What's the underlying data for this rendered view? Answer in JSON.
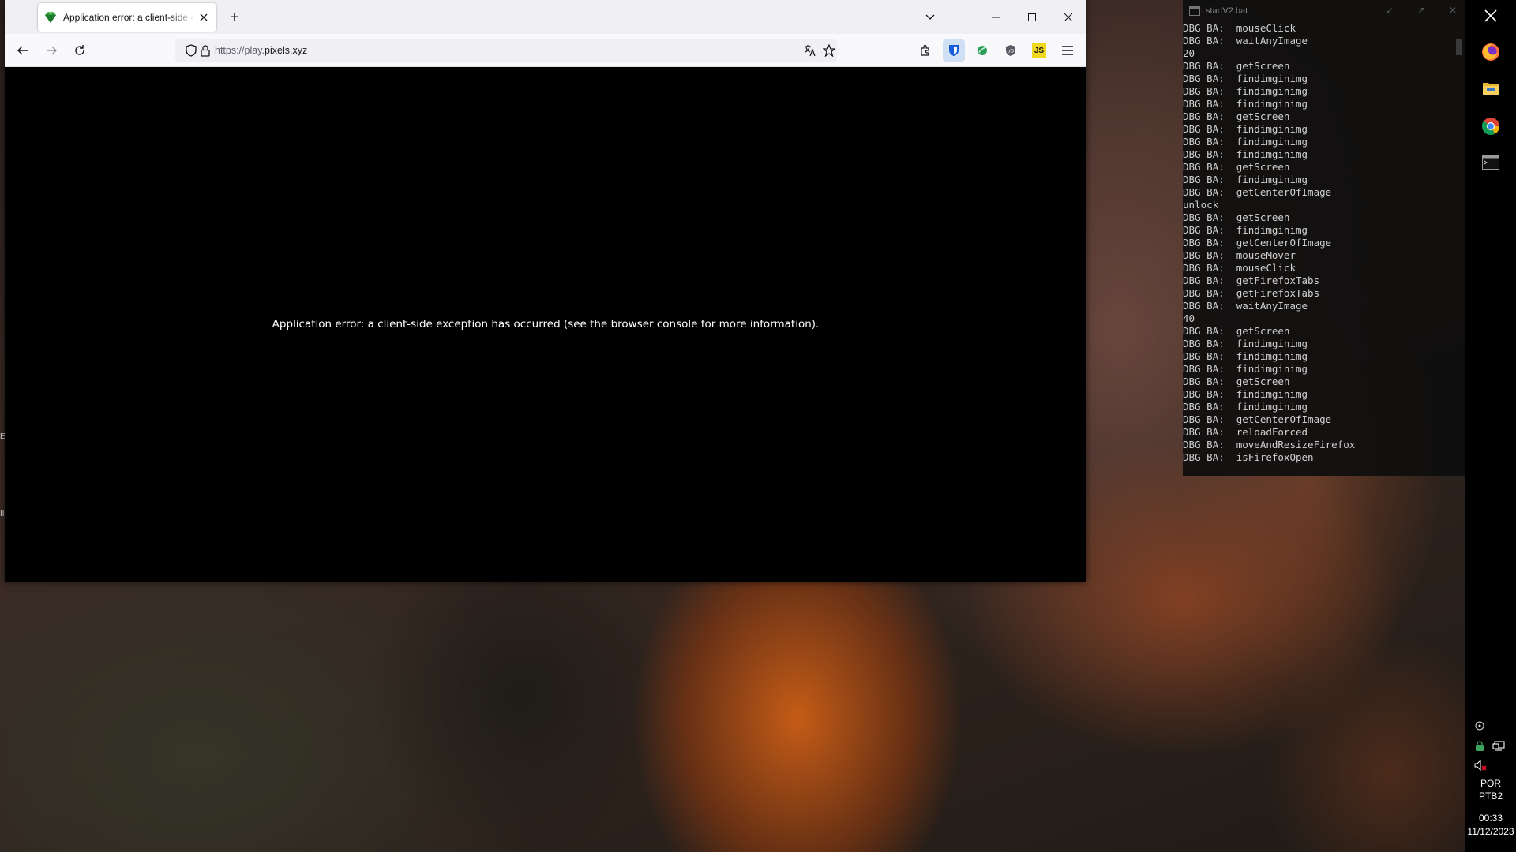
{
  "browser": {
    "tab": {
      "title": "Application error: a client-side exception has occurred"
    },
    "new_tab_symbol": "+",
    "url": {
      "protocol": "https://",
      "prefix": "play.",
      "host": "pixels.xyz"
    },
    "icons": {
      "back": "back-arrow-icon",
      "forward": "forward-arrow-icon",
      "reload": "reload-icon",
      "tracking": "shield-icon",
      "lock": "lock-icon",
      "translate": "translate-icon",
      "bookmark": "star-icon",
      "extensions": "puzzle-icon",
      "menu": "hamburger-menu-icon"
    },
    "extension_badge_js": "JS",
    "error_message": "Application error: a client-side exception has occurred (see the browser console for more information)."
  },
  "console": {
    "title": "startV2.bat",
    "lines": [
      "DBG BA:  mouseClick",
      "DBG BA:  waitAnyImage",
      "20",
      "DBG BA:  getScreen",
      "DBG BA:  findimginimg",
      "DBG BA:  findimginimg",
      "DBG BA:  findimginimg",
      "DBG BA:  getScreen",
      "DBG BA:  findimginimg",
      "DBG BA:  findimginimg",
      "DBG BA:  findimginimg",
      "DBG BA:  getScreen",
      "DBG BA:  findimginimg",
      "DBG BA:  getCenterOfImage",
      "unlock",
      "DBG BA:  getScreen",
      "DBG BA:  findimginimg",
      "DBG BA:  getCenterOfImage",
      "DBG BA:  mouseMover",
      "DBG BA:  mouseClick",
      "DBG BA:  getFirefoxTabs",
      "DBG BA:  getFirefoxTabs",
      "DBG BA:  waitAnyImage",
      "40",
      "DBG BA:  getScreen",
      "DBG BA:  findimginimg",
      "DBG BA:  findimginimg",
      "DBG BA:  findimginimg",
      "DBG BA:  getScreen",
      "DBG BA:  findimginimg",
      "DBG BA:  findimginimg",
      "DBG BA:  getCenterOfImage",
      "DBG BA:  reloadForced",
      "DBG BA:  moveAndResizeFirefox",
      "DBG BA:  isFirefoxOpen"
    ]
  },
  "taskbar": {
    "apps": [
      "firefox-icon",
      "file-explorer-icon",
      "chrome-icon",
      "terminal-icon"
    ],
    "language": "POR",
    "keyboard": "PTB2",
    "time": "00:33",
    "date": "11/12/2023"
  },
  "colors": {
    "accent_blue": "#0060df",
    "firefox_orange": "#ff7139",
    "chrome_red": "#db4437",
    "chrome_green": "#0f9d58",
    "chrome_yellow": "#f4b400"
  }
}
